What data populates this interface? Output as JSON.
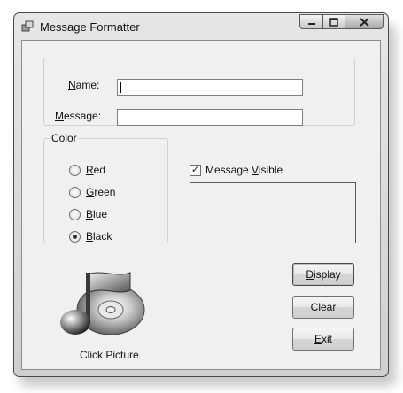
{
  "window": {
    "title": "Message Formatter"
  },
  "form": {
    "name_label": "Name:",
    "name_value": "",
    "message_label": "Message:",
    "message_value": ""
  },
  "color_group": {
    "title": "Color",
    "options": [
      {
        "label": "Red",
        "checked": false
      },
      {
        "label": "Green",
        "checked": false
      },
      {
        "label": "Blue",
        "checked": false
      },
      {
        "label": "Black",
        "checked": true
      }
    ]
  },
  "message_visible": {
    "label": "Message Visible",
    "checked": true
  },
  "message_panel": {
    "text": ""
  },
  "buttons": {
    "display": "Display",
    "clear": "Clear",
    "exit": "Exit"
  },
  "picture": {
    "caption": "Click Picture",
    "icon": "music-cd-icon"
  }
}
